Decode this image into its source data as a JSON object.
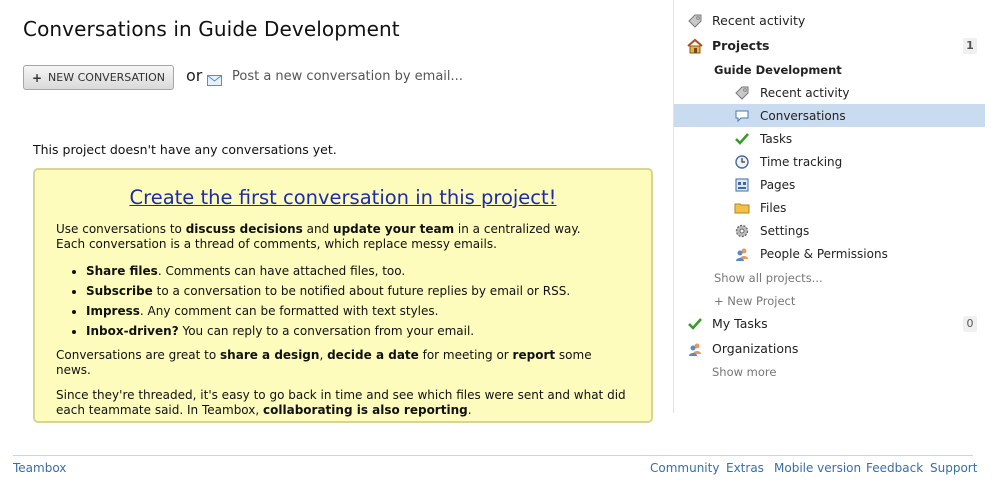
{
  "header": {
    "title": "Conversations in Guide Development"
  },
  "actions": {
    "new_conversation_plus": "+",
    "new_conversation_label": "NEW CONVERSATION",
    "or_text": "or",
    "email_link": "Post a new conversation by email..."
  },
  "empty_message": "This project doesn't have any conversations yet.",
  "intro": {
    "title": "Create the first conversation in this project!",
    "p1_line1": [
      {
        "t": "Use conversations to "
      },
      {
        "t": "discuss decisions",
        "b": true
      },
      {
        "t": " and "
      },
      {
        "t": "update your team",
        "b": true
      },
      {
        "t": " in a centralized way."
      }
    ],
    "p1_line2": "Each conversation is a thread of comments, which replace messy emails.",
    "bullets": [
      [
        {
          "t": "Share files",
          "b": true
        },
        {
          "t": ". Comments can have attached files, too."
        }
      ],
      [
        {
          "t": "Subscribe",
          "b": true
        },
        {
          "t": " to a conversation to be notified about future replies by email or RSS."
        }
      ],
      [
        {
          "t": "Impress",
          "b": true
        },
        {
          "t": ". Any comment can be formatted with text styles."
        }
      ],
      [
        {
          "t": "Inbox-driven?",
          "b": true
        },
        {
          "t": " You can reply to a conversation from your email."
        }
      ]
    ],
    "p2": [
      {
        "t": "Conversations are great to "
      },
      {
        "t": "share a design",
        "b": true
      },
      {
        "t": ", "
      },
      {
        "t": "decide a date",
        "b": true
      },
      {
        "t": " for meeting or "
      },
      {
        "t": "report",
        "b": true
      },
      {
        "t": " some news."
      }
    ],
    "p3": [
      {
        "t": "Since they're threaded, it's easy to go back in time and see which files were sent and what did each teammate said. In Teambox, "
      },
      {
        "t": "collaborating is also reporting",
        "b": true
      },
      {
        "t": "."
      }
    ]
  },
  "sidebar": {
    "recent_activity": "Recent activity",
    "projects": "Projects",
    "projects_count": "1",
    "project_name": "Guide Development",
    "project_items": [
      {
        "label": "Recent activity",
        "icon": "tag-icon"
      },
      {
        "label": "Conversations",
        "icon": "speech-bubble-icon",
        "selected": true
      },
      {
        "label": "Tasks",
        "icon": "checkmark-icon"
      },
      {
        "label": "Time tracking",
        "icon": "clock-icon"
      },
      {
        "label": "Pages",
        "icon": "pages-icon"
      },
      {
        "label": "Files",
        "icon": "folder-icon"
      },
      {
        "label": "Settings",
        "icon": "gear-icon"
      },
      {
        "label": "People & Permissions",
        "icon": "people-icon"
      }
    ],
    "show_all_projects": "Show all projects...",
    "new_project": "+ New Project",
    "my_tasks": "My Tasks",
    "my_tasks_count": "0",
    "organizations": "Organizations",
    "show_more": "Show more"
  },
  "footer": {
    "brand": "Teambox",
    "links": [
      "Community",
      "Extras",
      "Mobile version",
      "Feedback",
      "Support"
    ]
  },
  "colors": {
    "link_blue": "#1c2ca8",
    "intro_background": "#fdfcbd",
    "selected_row": "#c8dbef",
    "footer_link": "#3a6ea5"
  }
}
